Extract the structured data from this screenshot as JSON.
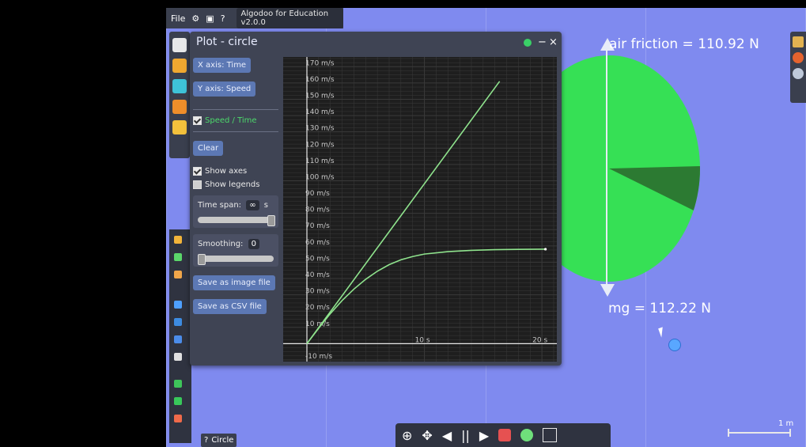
{
  "app": {
    "menu_file": "File",
    "title_chip": "Algodoo for Education v2.0.0",
    "help_icon": "?"
  },
  "plot_window": {
    "title": "Plot - circle",
    "controls": {
      "minimize": "−",
      "close": "×"
    },
    "buttons": {
      "x_axis": "X axis: Time",
      "y_axis": "Y axis: Speed",
      "clear": "Clear",
      "save_image": "Save as image file",
      "save_csv": "Save as CSV file"
    },
    "checks": {
      "speed_time": "Speed / Time",
      "show_axes": "Show axes",
      "show_legends": "Show legends"
    },
    "time_span": {
      "label": "Time span:",
      "value": "∞",
      "unit": "s",
      "slider_level": 1.0
    },
    "smoothing": {
      "label": "Smoothing:",
      "value": "0",
      "slider_level": 0.0
    }
  },
  "chart_data": {
    "type": "line",
    "title": "",
    "xlabel": "",
    "ylabel": "",
    "ylim": [
      -10,
      175
    ],
    "xlim": [
      0,
      21
    ],
    "y_ticks": [
      {
        "value": 170,
        "label": "170 m/s"
      },
      {
        "value": 160,
        "label": "160 m/s"
      },
      {
        "value": 150,
        "label": "150 m/s"
      },
      {
        "value": 140,
        "label": "140 m/s"
      },
      {
        "value": 130,
        "label": "130 m/s"
      },
      {
        "value": 120,
        "label": "120 m/s"
      },
      {
        "value": 110,
        "label": "110 m/s"
      },
      {
        "value": 100,
        "label": "100 m/s"
      },
      {
        "value": 90,
        "label": "90 m/s"
      },
      {
        "value": 80,
        "label": "80 m/s"
      },
      {
        "value": 70,
        "label": "70 m/s"
      },
      {
        "value": 60,
        "label": "60 m/s"
      },
      {
        "value": 50,
        "label": "50 m/s"
      },
      {
        "value": 40,
        "label": "40 m/s"
      },
      {
        "value": 30,
        "label": "30 m/s"
      },
      {
        "value": 20,
        "label": "20 m/s"
      },
      {
        "value": 10,
        "label": "10 m/s"
      },
      {
        "value": -10,
        "label": "-10 m/s"
      }
    ],
    "x_ticks": [
      {
        "value": 10,
        "label": "10 s"
      },
      {
        "value": 20,
        "label": "20 s"
      }
    ],
    "series": [
      {
        "x": [
          0,
          16.4
        ],
        "y": [
          0,
          161
        ]
      },
      {
        "x": [
          0,
          1,
          2,
          3,
          4,
          5,
          6,
          7,
          8,
          9,
          10,
          12,
          14,
          16,
          18,
          20.3
        ],
        "y": [
          0,
          9.5,
          18.5,
          26.5,
          33.5,
          39.5,
          44.5,
          48.5,
          51.5,
          53.5,
          55.0,
          56.5,
          57.3,
          57.7,
          57.9,
          58.0
        ]
      }
    ],
    "colors": {
      "line": "#8fe38d",
      "grid": "#3a3a3a",
      "axis": "#e6e6e6",
      "bg": "#1e1e1e",
      "tick": "#c6c6c6"
    }
  },
  "simulation": {
    "air_friction_label": "air friction = 110.92 N",
    "gravity_label": "mg = 112.22 N",
    "scale_label": "1 m",
    "colors": {
      "circle": "#36e055",
      "wedge": "#2c7a32",
      "background": "#7f8aef"
    }
  },
  "bottom_toolbar": {
    "zoom_icon": "⊕",
    "move_icon": "✥",
    "prev_icon": "◀",
    "pause_icon": "||",
    "next_icon": "▶"
  },
  "circle_badge": {
    "text": "Circle",
    "icon": "?"
  }
}
